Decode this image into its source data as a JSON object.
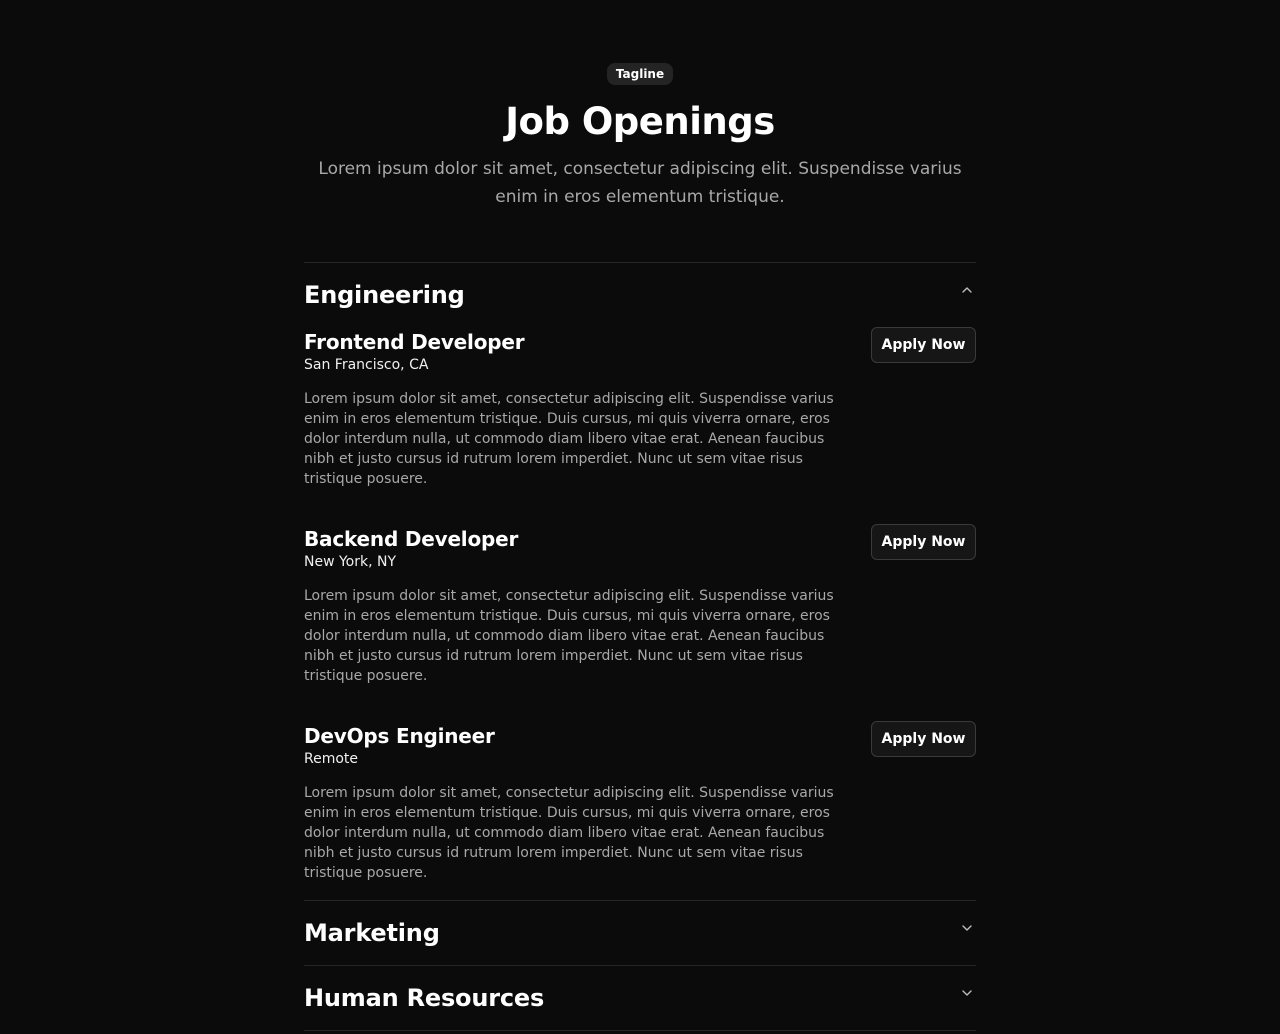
{
  "header": {
    "tagline": "Tagline",
    "title": "Job Openings",
    "subtitle": "Lorem ipsum dolor sit amet, consectetur adipiscing elit. Suspendisse varius enim in eros elementum tristique."
  },
  "sections": [
    {
      "title": "Engineering",
      "expanded": true,
      "chevron_icon": "chevron-up-icon",
      "jobs": [
        {
          "title": "Frontend Developer",
          "location": "San Francisco, CA",
          "description": "Lorem ipsum dolor sit amet, consectetur adipiscing elit. Suspendisse varius enim in eros elementum tristique. Duis cursus, mi quis viverra ornare, eros dolor interdum nulla, ut commodo diam libero vitae erat. Aenean faucibus nibh et justo cursus id rutrum lorem imperdiet. Nunc ut sem vitae risus tristique posuere.",
          "button_label": "Apply Now"
        },
        {
          "title": "Backend Developer",
          "location": "New York, NY",
          "description": "Lorem ipsum dolor sit amet, consectetur adipiscing elit. Suspendisse varius enim in eros elementum tristique. Duis cursus, mi quis viverra ornare, eros dolor interdum nulla, ut commodo diam libero vitae erat. Aenean faucibus nibh et justo cursus id rutrum lorem imperdiet. Nunc ut sem vitae risus tristique posuere.",
          "button_label": "Apply Now"
        },
        {
          "title": "DevOps Engineer",
          "location": "Remote",
          "description": "Lorem ipsum dolor sit amet, consectetur adipiscing elit. Suspendisse varius enim in eros elementum tristique. Duis cursus, mi quis viverra ornare, eros dolor interdum nulla, ut commodo diam libero vitae erat. Aenean faucibus nibh et justo cursus id rutrum lorem imperdiet. Nunc ut sem vitae risus tristique posuere.",
          "button_label": "Apply Now"
        }
      ]
    },
    {
      "title": "Marketing",
      "expanded": false,
      "chevron_icon": "chevron-down-icon",
      "jobs": []
    },
    {
      "title": "Human Resources",
      "expanded": false,
      "chevron_icon": "chevron-down-icon",
      "jobs": []
    }
  ],
  "colors": {
    "background": "#0b0b0b",
    "text_primary": "#ffffff",
    "text_muted": "#a8a8a8",
    "divider": "#262626",
    "tagline_bg": "#242424",
    "button_bg": "#161616",
    "button_border": "#3a3a3a"
  }
}
